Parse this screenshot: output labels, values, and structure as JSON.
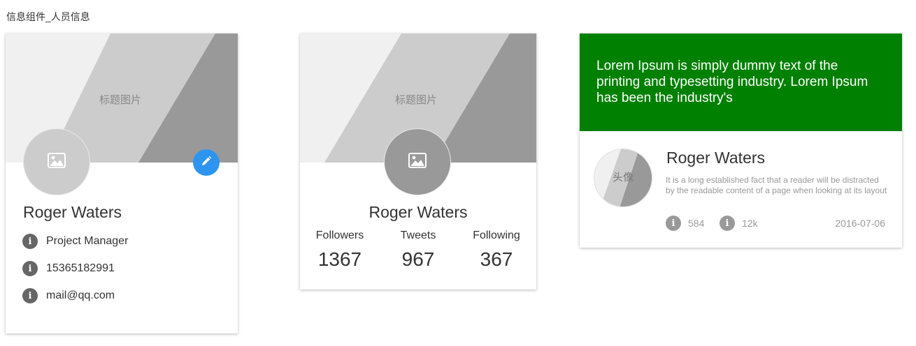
{
  "page": {
    "title": "信息组件_人员信息"
  },
  "card1": {
    "banner_label": "标题图片",
    "name": "Roger Waters",
    "info": [
      {
        "icon": "info-icon",
        "text": "Project Manager"
      },
      {
        "icon": "info-icon",
        "text": "15365182991"
      },
      {
        "icon": "info-icon",
        "text": "mail@qq.com"
      }
    ],
    "edit_icon": "pencil-icon",
    "info_glyph": "i",
    "colors": {
      "edit_button": "#2d95f0",
      "avatar": "#cccccc"
    }
  },
  "card2": {
    "banner_label": "标题图片",
    "name": "Roger Waters",
    "stats": [
      {
        "label": "Followers",
        "value": "1367"
      },
      {
        "label": "Tweets",
        "value": "967"
      },
      {
        "label": "Following",
        "value": "367"
      }
    ],
    "colors": {
      "avatar": "#999999"
    }
  },
  "card3": {
    "header_text": "Lorem Ipsum is simply dummy text of the printing and typesetting industry. Lorem Ipsum has been the industry's",
    "avatar_label": "头像",
    "name": "Roger Waters",
    "description": "It is a long established fact that a reader will be distracted by the readable content of a page when looking at its layout",
    "meta": [
      {
        "icon": "info-icon",
        "value": "584"
      },
      {
        "icon": "info-icon",
        "value": "12k"
      }
    ],
    "date": "2016-07-06",
    "info_glyph": "i",
    "colors": {
      "header": "#008000"
    }
  }
}
